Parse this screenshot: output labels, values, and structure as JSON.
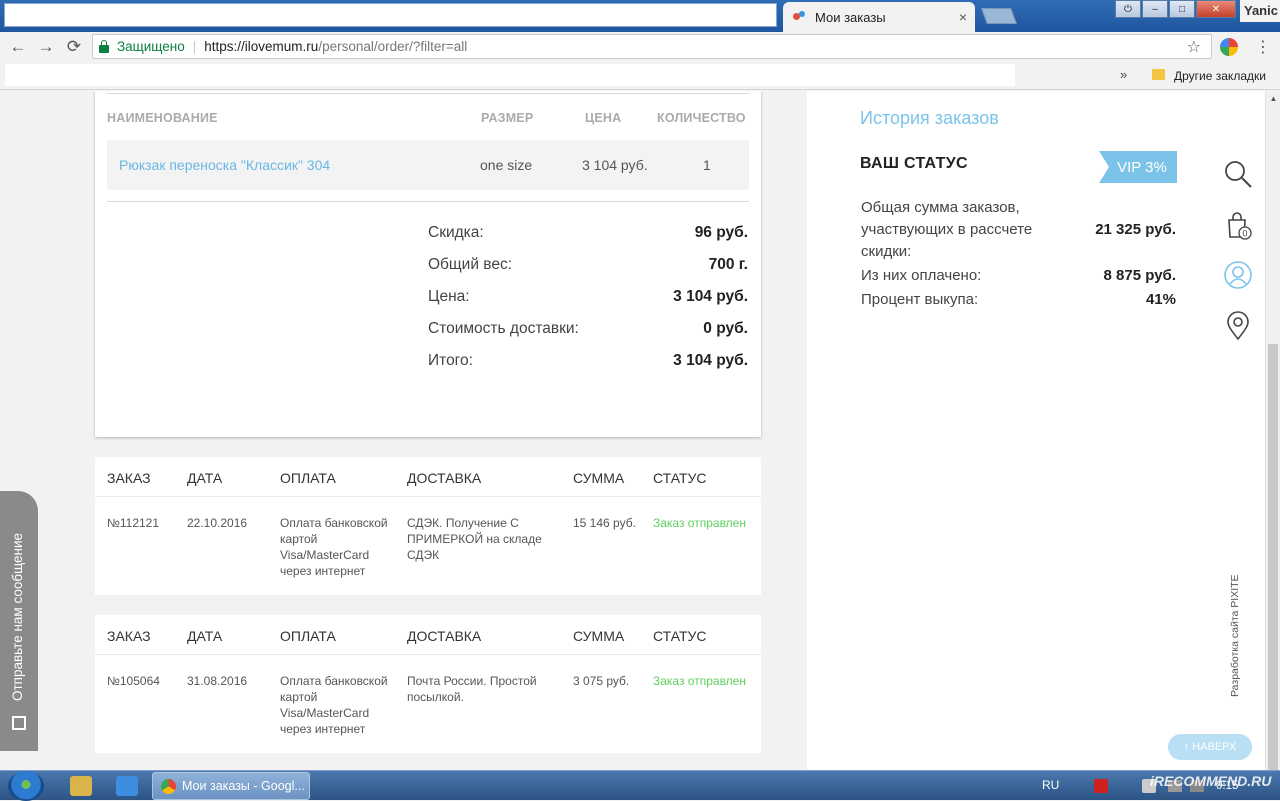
{
  "browser": {
    "tab_title": "Мои заказы",
    "tab_close": "×",
    "user_name": "Yanic",
    "nav": {
      "back": "←",
      "forward": "→",
      "reload": "⟳"
    },
    "omnibox": {
      "secure_label": "Защищено",
      "url_host": "https://ilovemum.ru",
      "url_path": "/personal/order/?filter=all"
    },
    "bookmarks": {
      "more": "»",
      "folder_label": "Другие закладки"
    }
  },
  "order_detail": {
    "columns": [
      "НАИМЕНОВАНИЕ",
      "РАЗМЕР",
      "ЦЕНА",
      "КОЛИЧЕСТВО"
    ],
    "item": {
      "name": "Рюкзак переноска \"Классик\" 304",
      "size": "one size",
      "price": "3 104 руб.",
      "qty": "1"
    },
    "summary": [
      {
        "label": "Скидка:",
        "value": "96 руб."
      },
      {
        "label": "Общий вес:",
        "value": "700 г."
      },
      {
        "label": "Цена:",
        "value": "3 104 руб."
      },
      {
        "label": "Стоимость доставки:",
        "value": "0 руб."
      },
      {
        "label": "Итого:",
        "value": "3 104 руб."
      }
    ]
  },
  "orders_headers": [
    "ЗАКАЗ",
    "ДАТА",
    "ОПЛАТА",
    "ДОСТАВКА",
    "СУММА",
    "СТАТУС"
  ],
  "orders": [
    {
      "number": "№112121",
      "date": "22.10.2016",
      "payment": "Оплата банковской картой Visa/MasterCard через интернет",
      "delivery": "СДЭК. Получение С ПРИМЕРКОЙ на складе СДЭК",
      "sum": "15 146 руб.",
      "status": "Заказ отправлен"
    },
    {
      "number": "№105064",
      "date": "31.08.2016",
      "payment": "Оплата банковской картой Visa/MasterCard через интернет",
      "delivery": "Почта России. Простой посылкой.",
      "sum": "3 075 руб.",
      "status": "Заказ отправлен"
    }
  ],
  "feedback": {
    "label": "Отправьте нам сообщение"
  },
  "sidebar": {
    "history_link": "История заказов",
    "status_title": "ВАШ СТАТУС",
    "vip_badge": "VIP 3%",
    "stats": [
      {
        "label": "Общая сумма заказов, участвующих в рассчете скидки:",
        "value": "21 325 руб."
      },
      {
        "label": "Из них оплачено:",
        "value": "8 875 руб."
      },
      {
        "label": "Процент выкупа:",
        "value": "41%"
      }
    ],
    "cart_count": "0",
    "dev_credit": "Разработка сайта PIXITE",
    "scroll_top": "↑ НАВЕРХ"
  },
  "taskbar": {
    "task_label": "Мои заказы - Googl...",
    "lang": "RU",
    "watermark": "iRECOMMEND.RU",
    "clock": "0:15"
  },
  "colors": {
    "link_blue": "#7cc3ea",
    "status_green": "#5fcf5f",
    "vip_badge_bg": "#7cc3ea"
  }
}
